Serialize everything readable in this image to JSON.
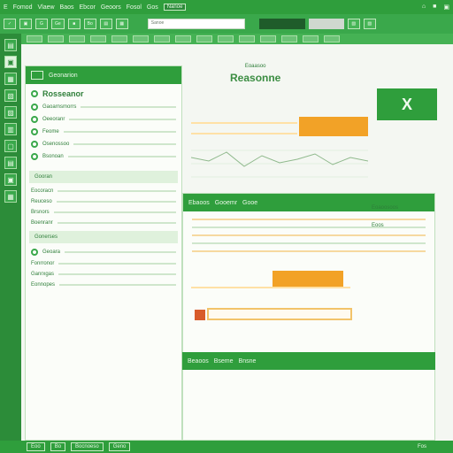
{
  "titlebar": {
    "items": [
      "E",
      "Fomod",
      "Vlaew",
      "Baos",
      "Ebcor",
      "Geoors",
      "Fosol",
      "Gos"
    ],
    "badge": "Nanoe",
    "right": [
      "⌂",
      "■",
      "▣"
    ]
  },
  "ribbon": {
    "buttons": [
      "✓",
      "▣",
      "G",
      "Ge",
      "■",
      "Bo",
      "▤",
      "▦",
      "▧",
      "▨"
    ],
    "search_text": "Sanoe"
  },
  "sidebar": {
    "icons": [
      "▤",
      "▣",
      "▦",
      "▧",
      "▨",
      "▥",
      "▢",
      "▤",
      "▣",
      "▦"
    ]
  },
  "left_panel": {
    "header": "Geonarion",
    "title": "Rosseanor",
    "items": [
      {
        "t": "Gaoarnsmorrs"
      },
      {
        "t": "Oeeoranr"
      },
      {
        "t": "Feome"
      },
      {
        "t": "Osenossoo"
      },
      {
        "t": "Bsonoan"
      }
    ],
    "subheads": [
      "Gooran",
      "Gonerses"
    ],
    "list2": [
      "Eocoracn",
      "Reuceso",
      "Brsnors",
      "Boenranr"
    ],
    "subhead3": "Geoara",
    "list3": [
      "Fonrronor",
      "Ganrxgas",
      "Eonnopes"
    ]
  },
  "content": {
    "small_title": "Eoaasoo",
    "big_title": "Reasonne",
    "logo_text": "X",
    "section_title": "Ebaoos",
    "section_items": [
      "Gooemr",
      "Gooe"
    ],
    "section2_title": "Beaoos",
    "section2_items": [
      "Bseme",
      "Bnsne"
    ],
    "right_label_1": "Eoaoosoos",
    "right_label_2": "Eoos"
  },
  "footer": {
    "tabs": [
      "Eoo",
      "Bo",
      "Bocnoeso",
      "Geno"
    ],
    "right": "Fos"
  },
  "colors": {
    "brand_green": "#2f9e3c",
    "accent_orange": "#f2a227",
    "accent_red": "#d85b2b"
  }
}
